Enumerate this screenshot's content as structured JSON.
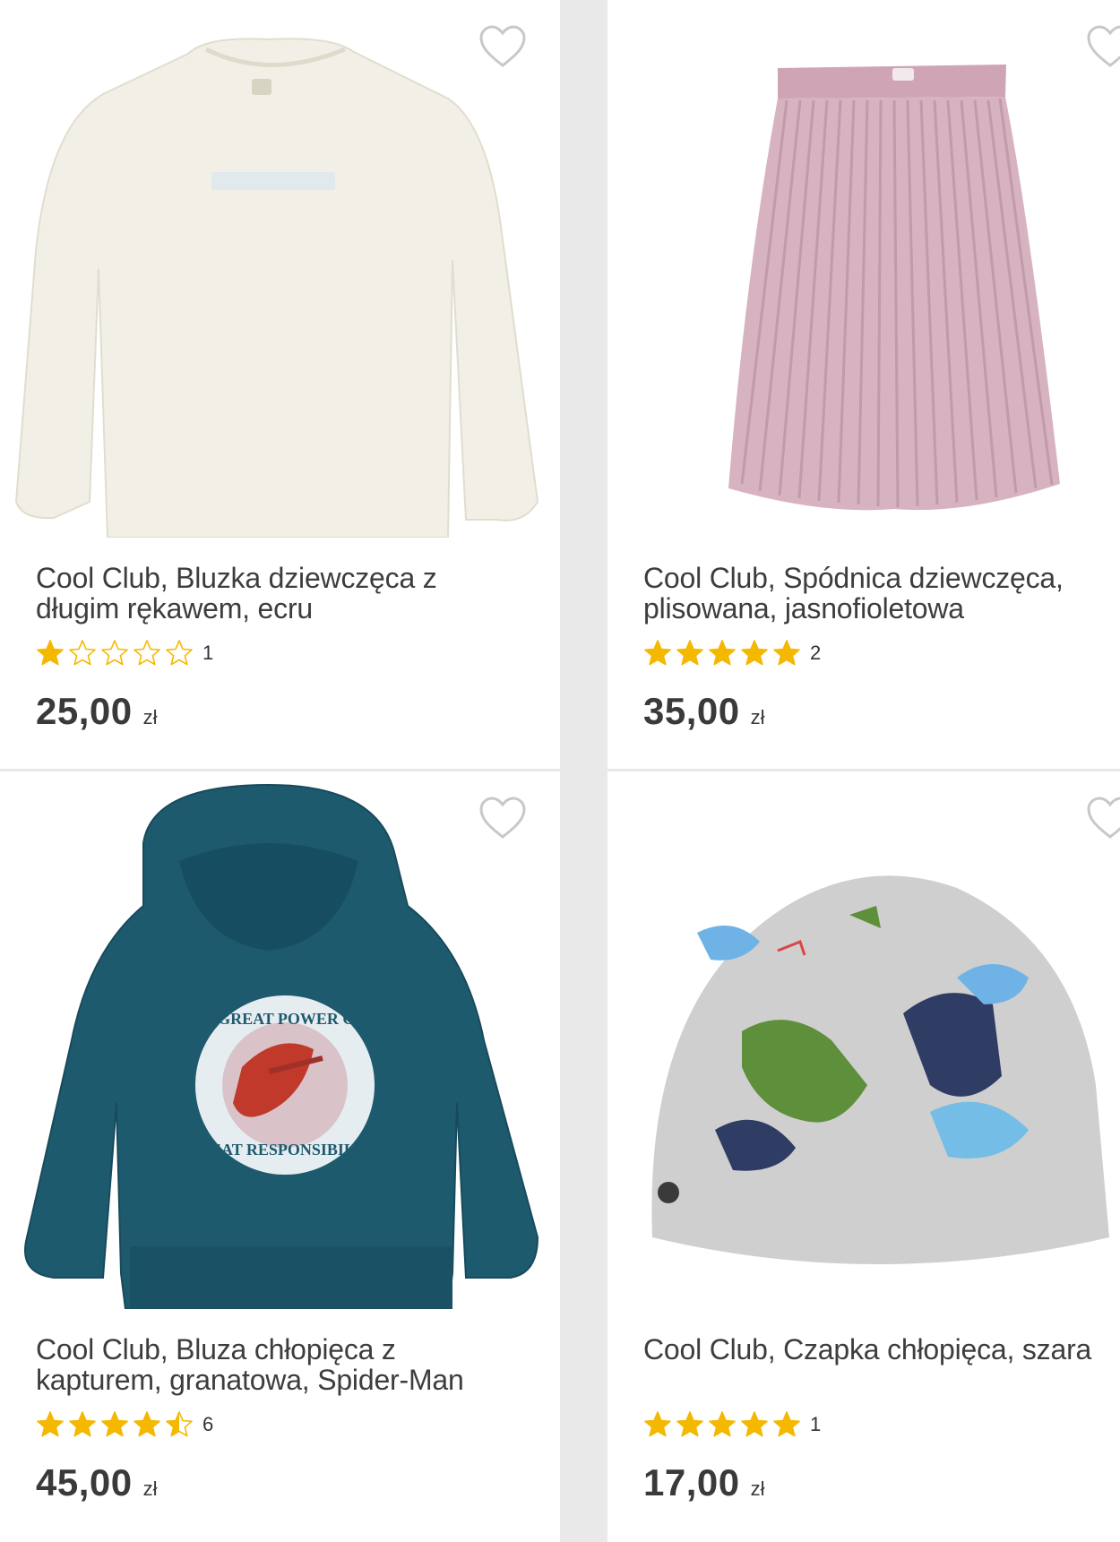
{
  "products": [
    {
      "title": "Cool Club, Bluzka dziewczęca z długim rękawem, ecru",
      "rating": 1,
      "rating_count": "1",
      "price": "25,00",
      "currency": "zł",
      "image": "cream-long-sleeve-top"
    },
    {
      "title": "Cool Club, Spódnica dziewczęca, plisowana, jasnofioletowa",
      "rating": 5,
      "rating_count": "2",
      "price": "35,00",
      "currency": "zł",
      "image": "pink-pleated-skirt"
    },
    {
      "title": "Cool Club, Bluza chłopięca z kapturem, granatowa, Spider-Man",
      "rating": 4.5,
      "rating_count": "6",
      "price": "45,00",
      "currency": "zł",
      "image": "teal-spiderman-hoodie",
      "print_top": "WITH GREAT POWER COMES",
      "print_bottom": "GREAT RESPONSIBILITY"
    },
    {
      "title": "Cool Club, Czapka chłopięca, szara",
      "rating": 5,
      "rating_count": "1",
      "price": "17,00",
      "currency": "zł",
      "image": "grey-dino-beanie"
    }
  ],
  "colors": {
    "star": "#f5b800",
    "price": "#3a3a3a",
    "favorite_outline": "#c8c8c8"
  }
}
